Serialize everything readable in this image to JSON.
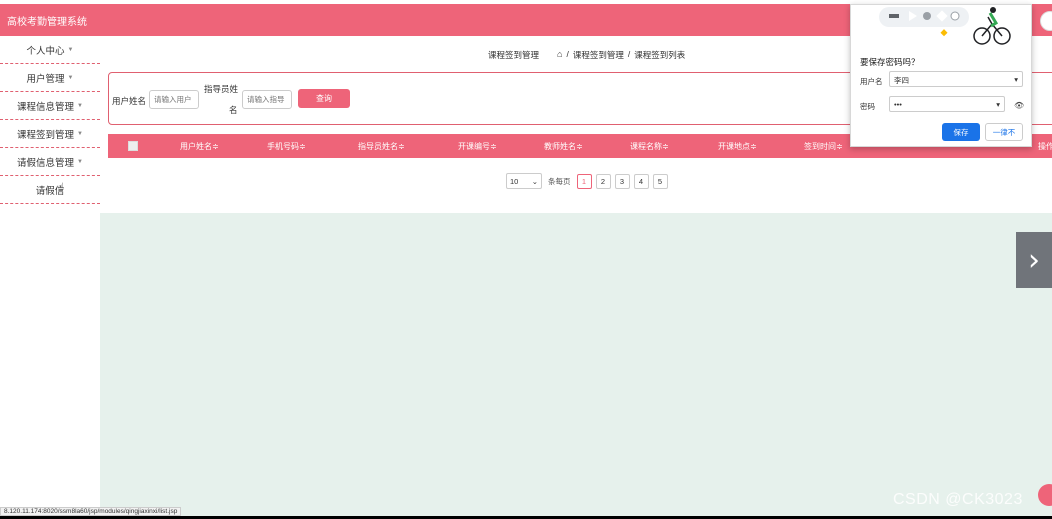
{
  "app": {
    "title": "高校考勤管理系统"
  },
  "sidebar": {
    "items": [
      {
        "label": "个人中心",
        "caret": true
      },
      {
        "label": "用户管理",
        "caret": true
      },
      {
        "label": "课程信息管理",
        "caret": true
      },
      {
        "label": "课程签到管理",
        "caret": true
      },
      {
        "label": "请假信息管理",
        "caret": true
      },
      {
        "label": "请假信",
        "caret": false
      }
    ]
  },
  "breadcrumb": {
    "left": "课程签到管理",
    "sep1": "/",
    "mid": "课程签到管理",
    "sep2": "/",
    "right": "课程签到列表"
  },
  "search": {
    "user_label": "用户姓名",
    "user_placeholder": "请输入用户",
    "advisor_label_1": "指导员姓",
    "advisor_label_2": "名",
    "advisor_placeholder": "请输入指导",
    "query_button": "查询"
  },
  "table": {
    "columns": [
      "用户姓名≑",
      "手机号码≑",
      "指导员姓名≑",
      "开课编号≑",
      "教师姓名≑",
      "课程名称≑",
      "开课地点≑",
      "签到时间≑",
      "操作"
    ]
  },
  "pagination": {
    "page_size": "10",
    "per_page_label": "条每页",
    "pages": [
      "1",
      "2",
      "3",
      "4",
      "5"
    ],
    "current": "1"
  },
  "password_dialog": {
    "title": "要保存密码吗？",
    "username_label": "用户名",
    "username_value": "李四",
    "password_label": "密码",
    "password_value": "•••",
    "save_button": "保存",
    "never_button": "一律不"
  },
  "statusbar": {
    "url": "8.120.11.174:8020/ssm8la60/jsp/modules/qingjiaxinxi/list.jsp"
  },
  "watermark": {
    "text": "CSDN @CK3023"
  },
  "colors": {
    "accent": "#ee6479",
    "content_bg": "#e6f1ec",
    "dialog_button": "#1a73e8"
  }
}
